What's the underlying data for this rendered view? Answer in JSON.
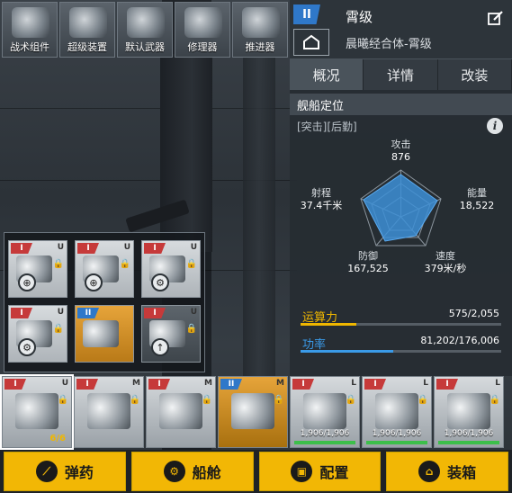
{
  "categories": [
    {
      "label": "战术组件",
      "icon": "tactical-module-icon"
    },
    {
      "label": "超级装置",
      "icon": "super-device-icon"
    },
    {
      "label": "默认武器",
      "icon": "default-weapon-icon"
    },
    {
      "label": "修理器",
      "icon": "repair-device-icon"
    },
    {
      "label": "推进器",
      "icon": "thruster-icon"
    }
  ],
  "ship": {
    "tier": "II",
    "name": "霄级",
    "full_name": "晨曦经合体-霄级"
  },
  "tabs": [
    {
      "label": "概况",
      "active": true
    },
    {
      "label": "详情",
      "active": false
    },
    {
      "label": "改装",
      "active": false
    }
  ],
  "positioning": {
    "title": "舰船定位",
    "roles": "[突击][后勤]"
  },
  "stats": {
    "attack": {
      "label": "攻击",
      "value": "876"
    },
    "energy": {
      "label": "能量",
      "value": "18,522"
    },
    "speed": {
      "label": "速度",
      "value": "379米/秒"
    },
    "defense": {
      "label": "防御",
      "value": "167,525"
    },
    "range": {
      "label": "射程",
      "value": "37.4千米"
    }
  },
  "capacity": {
    "label": "运算力",
    "value": "575/2,055",
    "fraction": 0.28
  },
  "power": {
    "label": "功率",
    "value": "81,202/176,006",
    "fraction": 0.46
  },
  "popup_modules": [
    {
      "tier": "I",
      "tier_color": "red",
      "slot": "U",
      "locked": true,
      "style": "light",
      "icon": "crosshair-icon"
    },
    {
      "tier": "I",
      "tier_color": "red",
      "slot": "U",
      "locked": true,
      "style": "light",
      "icon": "crosshair-icon"
    },
    {
      "tier": "I",
      "tier_color": "red",
      "slot": "U",
      "locked": true,
      "style": "light",
      "icon": "gear-icon"
    },
    {
      "tier": "I",
      "tier_color": "red",
      "slot": "U",
      "locked": true,
      "style": "light",
      "icon": "gear-icon"
    },
    {
      "tier": "II",
      "tier_color": "blue",
      "slot": "",
      "locked": false,
      "style": "gold",
      "icon": "weapon-icon"
    },
    {
      "tier": "I",
      "tier_color": "red",
      "slot": "U",
      "locked": true,
      "style": "dark",
      "icon": "upgrade-arrow-icon"
    }
  ],
  "bottom_slots": [
    {
      "tier": "I",
      "tier_color": "red",
      "slot": "U",
      "locked": true,
      "style": "light",
      "count": "6/6",
      "hp": ""
    },
    {
      "tier": "I",
      "tier_color": "red",
      "slot": "M",
      "locked": true,
      "style": "light",
      "count": "",
      "hp": ""
    },
    {
      "tier": "I",
      "tier_color": "red",
      "slot": "M",
      "locked": true,
      "style": "light",
      "count": "",
      "hp": ""
    },
    {
      "tier": "II",
      "tier_color": "blue",
      "slot": "M",
      "locked": true,
      "style": "gold",
      "count": "",
      "hp": ""
    },
    {
      "tier": "I",
      "tier_color": "red",
      "slot": "L",
      "locked": true,
      "style": "light",
      "count": "",
      "hp": "1,906/1,906"
    },
    {
      "tier": "I",
      "tier_color": "red",
      "slot": "L",
      "locked": true,
      "style": "light",
      "count": "",
      "hp": "1,906/1,906"
    },
    {
      "tier": "I",
      "tier_color": "red",
      "slot": "L",
      "locked": true,
      "style": "light",
      "count": "",
      "hp": "1,906/1,906"
    }
  ],
  "actions": [
    {
      "label": "弹药",
      "icon": "ammo-icon"
    },
    {
      "label": "船舱",
      "icon": "cabin-icon"
    },
    {
      "label": "配置",
      "icon": "config-icon"
    },
    {
      "label": "装箱",
      "icon": "crate-icon"
    }
  ],
  "colors": {
    "accent_yellow": "#f2b705",
    "accent_blue": "#3a9ae8",
    "tier_red": "#c63a3a",
    "tier_blue": "#2f78c9",
    "radar_fill": "#3d8fd6"
  }
}
